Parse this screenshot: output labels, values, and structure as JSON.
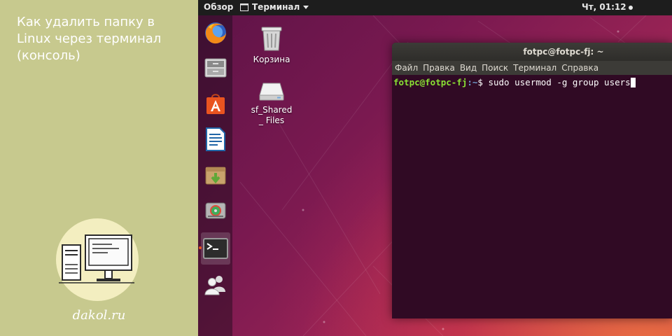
{
  "article": {
    "title": "Как удалить папку в Linux через терминал (консоль)",
    "site": "dakol.ru"
  },
  "top_bar": {
    "activities": "Обзор",
    "app_menu": "Терминал",
    "clock": "Чт, 01:12"
  },
  "dock": {
    "items": [
      {
        "icon": "firefox-icon"
      },
      {
        "icon": "file-manager-icon"
      },
      {
        "icon": "software-center-icon"
      },
      {
        "icon": "writer-icon"
      },
      {
        "icon": "archive-manager-icon"
      },
      {
        "icon": "disks-icon"
      },
      {
        "icon": "terminal-icon",
        "active": true
      },
      {
        "icon": "users-icon"
      }
    ]
  },
  "desktop_icons": [
    {
      "label": "Корзина",
      "icon": "trash-icon"
    },
    {
      "label": "sf_Shared_ Files",
      "icon": "drive-icon"
    }
  ],
  "terminal": {
    "title": "fotpc@fotpc-fj: ~",
    "menu": [
      "Файл",
      "Правка",
      "Вид",
      "Поиск",
      "Терминал",
      "Справка"
    ],
    "prompt_user": "fotpc@fotpc-fj",
    "prompt_path": ":~",
    "prompt_symbol": "$ ",
    "command": "sudo usermod -g group users"
  },
  "colors": {
    "left_panel": "#c7c98e",
    "terminal_bg": "#300a24",
    "prompt_green": "#8ae234",
    "prompt_blue": "#729fcf",
    "ubuntu_orange": "#e95420"
  }
}
